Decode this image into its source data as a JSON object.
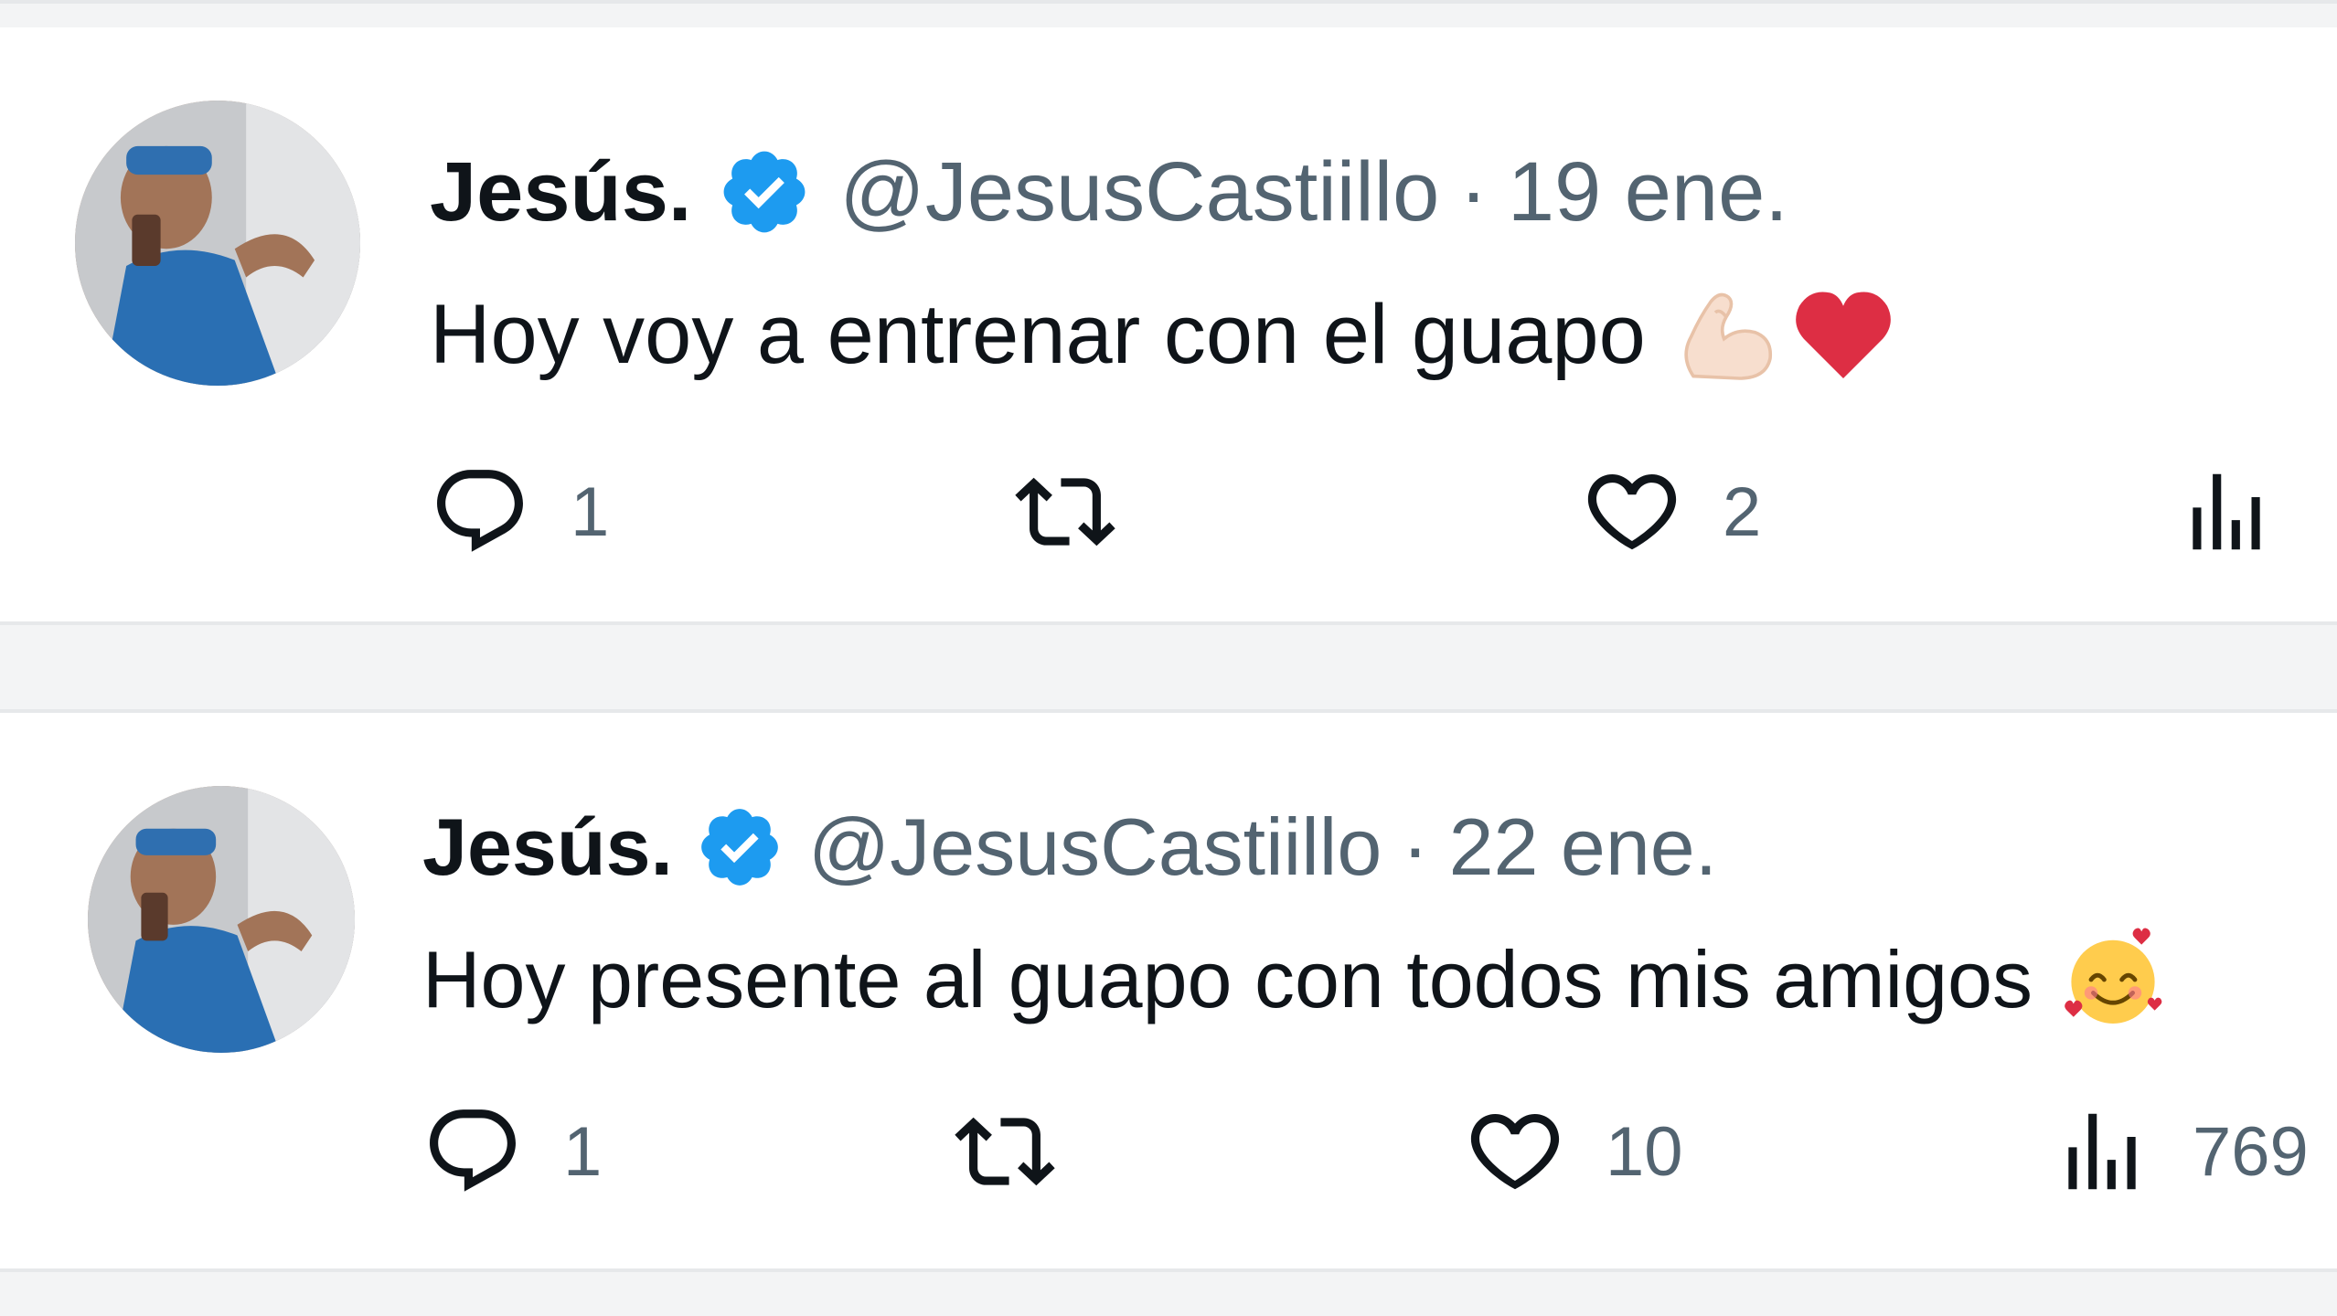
{
  "colors": {
    "verified_blue": "#1d9bf0",
    "text_primary": "#0f1419",
    "text_secondary": "#536471",
    "heart_red": "#dd2e44"
  },
  "tweets": [
    {
      "display_name": "Jesús.",
      "handle": "@JesusCastiillo",
      "separator": "·",
      "date": "19 ene.",
      "text": "Hoy voy a entrenar con el guapo",
      "emojis": [
        "flexed-biceps-emoji",
        "red-heart-emoji"
      ],
      "actions": {
        "reply_count": "1",
        "retweet_count": "",
        "like_count": "2",
        "view_count": ""
      }
    },
    {
      "display_name": "Jesús.",
      "handle": "@JesusCastiillo",
      "separator": "·",
      "date": "22 ene.",
      "text": "Hoy presente al guapo con todos mis amigos",
      "emojis": [
        "smiling-face-with-hearts-emoji"
      ],
      "actions": {
        "reply_count": "1",
        "retweet_count": "",
        "like_count": "10",
        "view_count": "769"
      }
    }
  ]
}
